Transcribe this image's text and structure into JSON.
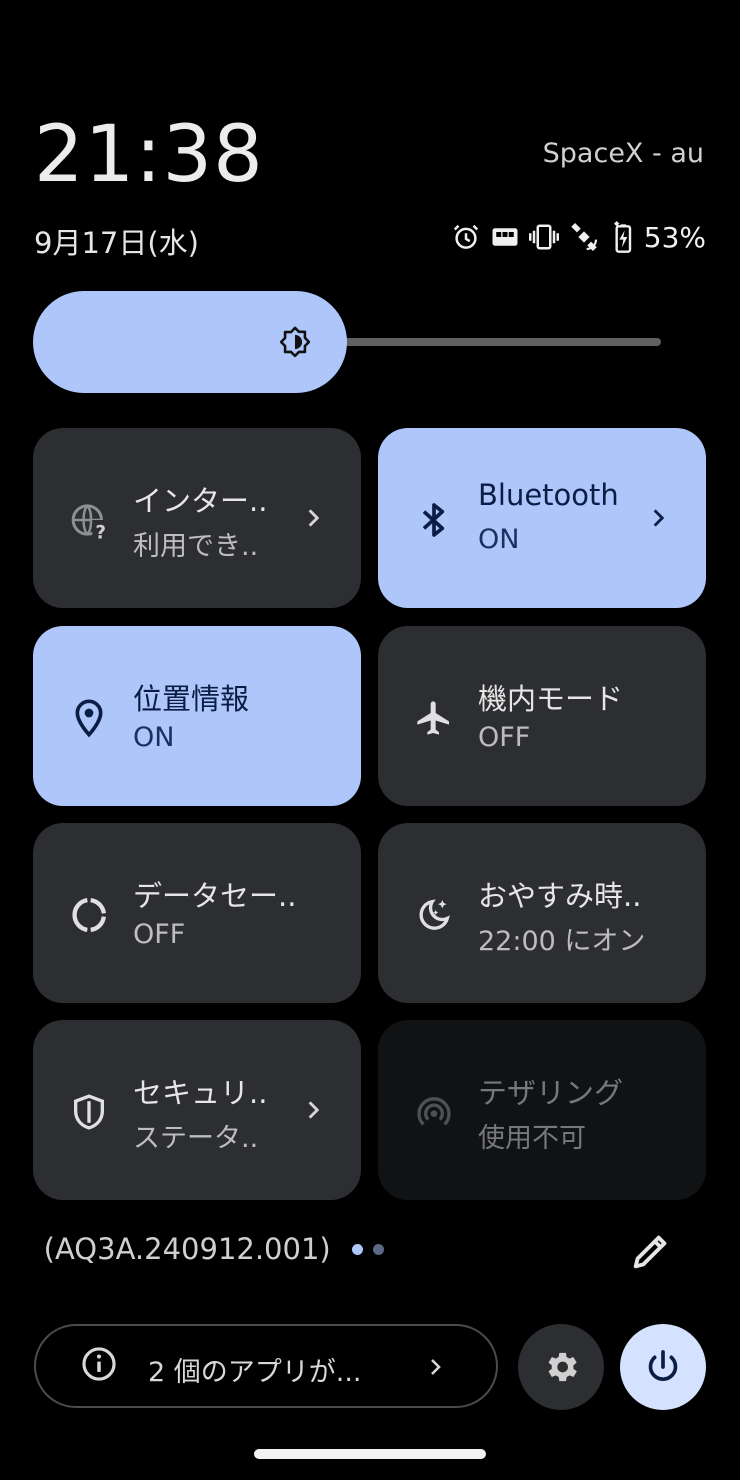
{
  "header": {
    "time": "21:38",
    "carrier": "SpaceX - au",
    "date": "9月17日(水)",
    "battery": "53%"
  },
  "status_icons": [
    "alarm-icon",
    "sim-card-icon",
    "vibrate-icon",
    "satellite-icon",
    "battery-charging-icon"
  ],
  "brightness": {
    "level": 0.42,
    "icon": "brightness-icon"
  },
  "tiles": [
    {
      "title": "インター..",
      "subtitle": "利用でき..",
      "state": "off",
      "icon": "internet-icon",
      "chevron": true
    },
    {
      "title": "Bluetooth",
      "subtitle": "ON",
      "state": "on",
      "icon": "bluetooth-icon",
      "chevron": true
    },
    {
      "title": "位置情報",
      "subtitle": "ON",
      "state": "on",
      "icon": "location-icon",
      "chevron": false
    },
    {
      "title": "機内モード",
      "subtitle": "OFF",
      "state": "off",
      "icon": "airplane-icon",
      "chevron": false
    },
    {
      "title": "データセー..",
      "subtitle": "OFF",
      "state": "off",
      "icon": "data-saver-icon",
      "chevron": false
    },
    {
      "title": "おやすみ時..",
      "subtitle": "22:00 にオン",
      "state": "off",
      "icon": "bedtime-icon",
      "chevron": false
    },
    {
      "title": "セキュリ..",
      "subtitle": "ステータ..",
      "state": "off",
      "icon": "security-shield-icon",
      "chevron": true
    },
    {
      "title": "テザリング",
      "subtitle": "使用不可",
      "state": "disabled",
      "icon": "hotspot-icon",
      "chevron": false
    }
  ],
  "footer": {
    "build": "5 (AQ3A.240912.001)",
    "page_count": 2,
    "active_page": 0,
    "notice": "2 個のアプリが...",
    "edit_icon": "pencil-icon",
    "settings_icon": "gear-icon",
    "power_icon": "power-icon"
  },
  "colors": {
    "background": "#000000",
    "tile_off": "#2d2e31",
    "tile_on": "#aec6f9",
    "tile_disabled": "#111214",
    "power_button": "#d5e2ff"
  }
}
